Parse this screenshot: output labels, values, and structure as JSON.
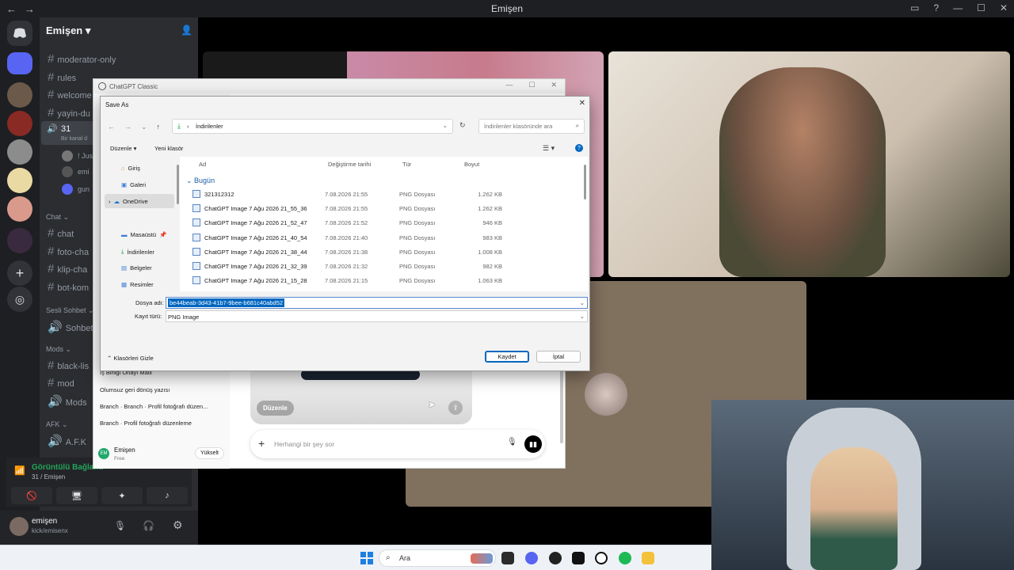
{
  "window": {
    "title": "Emişen"
  },
  "server": {
    "name": "Emişen"
  },
  "channels": [
    {
      "label": "moderator-only"
    },
    {
      "label": "rules"
    },
    {
      "label": "welcome"
    },
    {
      "label": "yayin-du"
    },
    {
      "label": "31",
      "sub": "Bir kanal d"
    }
  ],
  "voice_users": [
    "! Just",
    "emi",
    "gun"
  ],
  "chat_category": "Chat",
  "chat_channels": [
    "chat",
    "foto-cha",
    "klip-cha",
    "bot-kom"
  ],
  "sesli_category": "Sesli Sohbet",
  "sesli_channels": [
    "Sohbet O"
  ],
  "mods_category": "Mods",
  "mods_channels": [
    "black-lis",
    "mod",
    "Mods"
  ],
  "afk_category": "AFK",
  "afk_channels": [
    "A.F.K"
  ],
  "voice": {
    "status": "Görüntülü Bağlantı",
    "location": "31 / Emişen"
  },
  "user": {
    "name": "emişen",
    "status": "kick/emisenx"
  },
  "chatgpt": {
    "title": "ChatGPT Classic",
    "history": [
      "İş Birliği Onayı Maili",
      "Olumsuz geri dönüş yazısı",
      "Branch · Branch · Profil fotoğrafı düzen...",
      "Branch · Profil fotoğrafı düzenleme"
    ],
    "account_name": "Emişen",
    "account_plan": "Free",
    "upgrade": "Yükselt",
    "edit_label": "Düzenle",
    "prompt_placeholder": "Herhangi bir şey sor"
  },
  "dialog": {
    "title": "Save As",
    "path": "İndirilenler",
    "search_placeholder": "İndirilenler klasöründe ara",
    "organize": "Düzenle",
    "new_folder": "Yeni klasör",
    "sidebar": [
      "Giriş",
      "Galeri",
      "OneDrive",
      "Masaüstü",
      "İndirilenler",
      "Belgeler",
      "Resimler"
    ],
    "columns": [
      "Ad",
      "Değiştirme tarihi",
      "Tür",
      "Boyut"
    ],
    "group": "Bugün",
    "files": [
      {
        "name": "321312312",
        "date": "7.08.2026 21:55",
        "type": "PNG Dosyası",
        "size": "1.262 KB"
      },
      {
        "name": "ChatGPT Image 7 Ağu 2026 21_55_36",
        "date": "7.08.2026 21:55",
        "type": "PNG Dosyası",
        "size": "1.262 KB"
      },
      {
        "name": "ChatGPT Image 7 Ağu 2026 21_52_47",
        "date": "7.08.2026 21:52",
        "type": "PNG Dosyası",
        "size": "946 KB"
      },
      {
        "name": "ChatGPT Image 7 Ağu 2026 21_40_54",
        "date": "7.08.2026 21:40",
        "type": "PNG Dosyası",
        "size": "983 KB"
      },
      {
        "name": "ChatGPT Image 7 Ağu 2026 21_38_44",
        "date": "7.08.2026 21:38",
        "type": "PNG Dosyası",
        "size": "1.008 KB"
      },
      {
        "name": "ChatGPT Image 7 Ağu 2026 21_32_39",
        "date": "7.08.2026 21:32",
        "type": "PNG Dosyası",
        "size": "982 KB"
      },
      {
        "name": "ChatGPT Image 7 Ağu 2026 21_15_28",
        "date": "7.08.2026 21:15",
        "type": "PNG Dosyası",
        "size": "1.063 KB"
      }
    ],
    "filename_label": "Dosya adı:",
    "filename": "be44beab-3d43-41b7-9bee-b681c40abd52",
    "filetype_label": "Kayıt türü:",
    "filetype": "PNG Image",
    "hide_folders": "Klasörleri Gizle",
    "save": "Kaydet",
    "cancel": "İptal"
  },
  "taskbar": {
    "search": "Ara"
  }
}
